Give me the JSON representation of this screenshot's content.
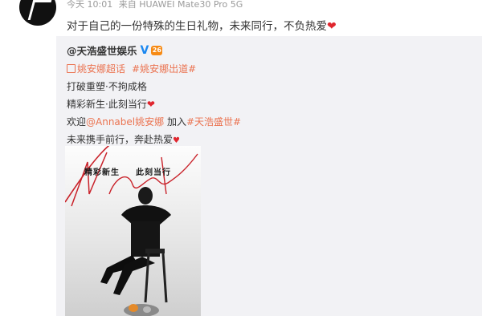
{
  "post": {
    "time": "今天 10:01",
    "source": "来自 HUAWEI Mate30 Pro 5G",
    "text": "对于自己的一份特殊的生日礼物，未来同行，不负热爱"
  },
  "repost": {
    "author": "@天浩盛世娱乐",
    "level": "26",
    "topics": [
      "姚安娜超话",
      "#姚安娜出道#"
    ],
    "line1": "打破重塑·不拘成格",
    "line2": "精彩新生·此刻当行",
    "line3_pre": "欢迎",
    "line3_mention": "@Annabel姚安娜",
    "line3_mid": " 加入",
    "line3_tag": "#天浩盛世#",
    "line4": "未来携手前行，奔赴热爱",
    "poster": {
      "slogan_left": "精彩新生",
      "slogan_right": "此刻当行",
      "signature": "Annabel"
    }
  },
  "icons": {
    "verified": "verified-v-icon",
    "heart": "red-heart-icon",
    "topic": "supertopic-icon"
  },
  "colors": {
    "link": "#eb7350",
    "heart": "#e0262e",
    "verified": "#1a87f0"
  }
}
